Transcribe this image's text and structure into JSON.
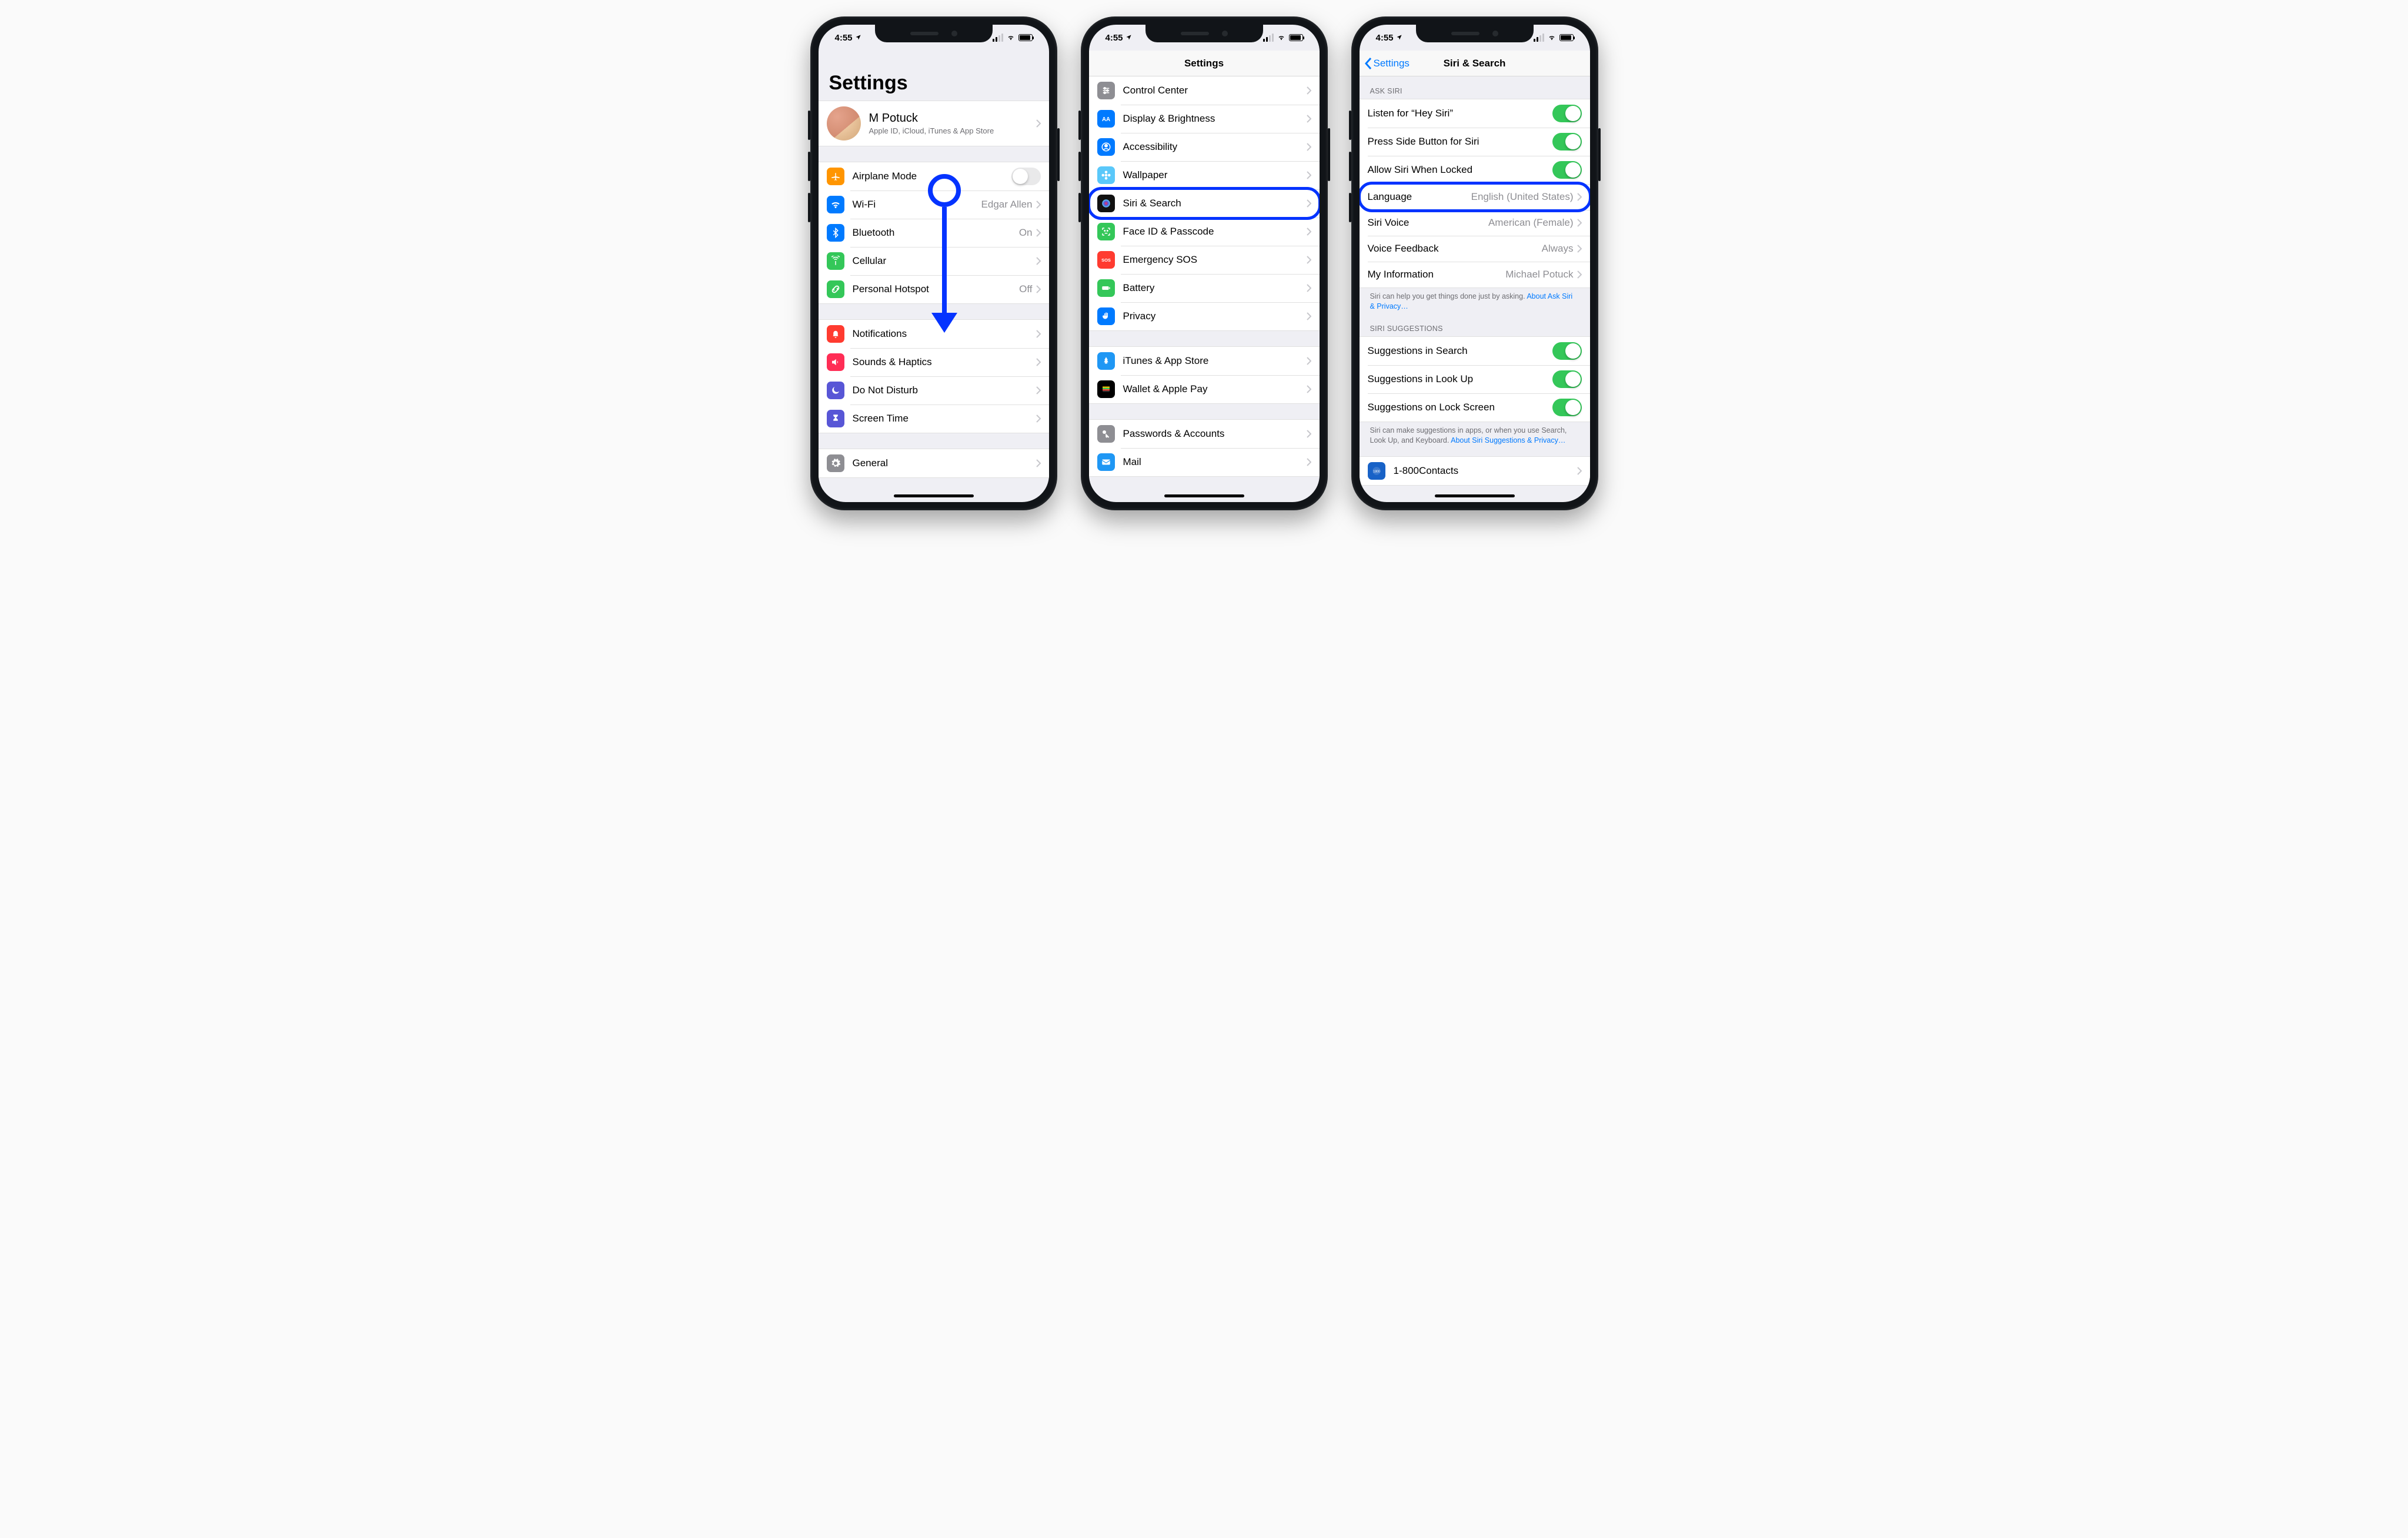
{
  "status": {
    "time": "4:55",
    "locArrow": true
  },
  "phone1": {
    "title": "Settings",
    "profile": {
      "name": "M Potuck",
      "sub": "Apple ID, iCloud, iTunes & App Store"
    },
    "g1": [
      {
        "k": "airplane",
        "label": "Airplane Mode",
        "toggle": "off"
      },
      {
        "k": "wifi",
        "label": "Wi-Fi",
        "detail": "Edgar Allen"
      },
      {
        "k": "bt",
        "label": "Bluetooth",
        "detail": "On"
      },
      {
        "k": "cell",
        "label": "Cellular"
      },
      {
        "k": "hotspot",
        "label": "Personal Hotspot",
        "detail": "Off"
      }
    ],
    "g2": [
      {
        "k": "notif",
        "label": "Notifications"
      },
      {
        "k": "sounds",
        "label": "Sounds & Haptics"
      },
      {
        "k": "dnd",
        "label": "Do Not Disturb"
      },
      {
        "k": "screentime",
        "label": "Screen Time"
      }
    ],
    "g3": [
      {
        "k": "general",
        "label": "General"
      }
    ]
  },
  "phone2": {
    "navTitle": "Settings",
    "rows": [
      {
        "k": "cc",
        "label": "Control Center"
      },
      {
        "k": "display",
        "label": "Display & Brightness"
      },
      {
        "k": "access",
        "label": "Accessibility"
      },
      {
        "k": "wallpaper",
        "label": "Wallpaper"
      },
      {
        "k": "siri",
        "label": "Siri & Search",
        "hl": true
      },
      {
        "k": "faceid",
        "label": "Face ID & Passcode"
      },
      {
        "k": "sos",
        "label": "Emergency SOS"
      },
      {
        "k": "battery",
        "label": "Battery"
      },
      {
        "k": "privacy",
        "label": "Privacy"
      }
    ],
    "g2": [
      {
        "k": "itunes",
        "label": "iTunes & App Store"
      },
      {
        "k": "wallet",
        "label": "Wallet & Apple Pay"
      }
    ],
    "g3": [
      {
        "k": "passwords",
        "label": "Passwords & Accounts"
      },
      {
        "k": "mail",
        "label": "Mail"
      }
    ]
  },
  "phone3": {
    "back": "Settings",
    "navTitle": "Siri & Search",
    "askHeader": "ASK SIRI",
    "ask": [
      {
        "k": "hey",
        "label": "Listen for “Hey Siri”",
        "toggle": "on"
      },
      {
        "k": "side",
        "label": "Press Side Button for Siri",
        "toggle": "on"
      },
      {
        "k": "locked",
        "label": "Allow Siri When Locked",
        "toggle": "on"
      },
      {
        "k": "lang",
        "label": "Language",
        "detail": "English (United States)",
        "hl": true
      },
      {
        "k": "voice",
        "label": "Siri Voice",
        "detail": "American (Female)"
      },
      {
        "k": "feedback",
        "label": "Voice Feedback",
        "detail": "Always"
      },
      {
        "k": "myinfo",
        "label": "My Information",
        "detail": "Michael Potuck"
      }
    ],
    "askFooter": "Siri can help you get things done just by asking. ",
    "askFooterLink": "About Ask Siri & Privacy…",
    "sugHeader": "SIRI SUGGESTIONS",
    "sug": [
      {
        "k": "ssearch",
        "label": "Suggestions in Search",
        "toggle": "on"
      },
      {
        "k": "slookup",
        "label": "Suggestions in Look Up",
        "toggle": "on"
      },
      {
        "k": "slock",
        "label": "Suggestions on Lock Screen",
        "toggle": "on"
      }
    ],
    "sugFooter": "Siri can make suggestions in apps, or when you use Search, Look Up, and Keyboard. ",
    "sugFooterLink": "About Siri Suggestions & Privacy…",
    "app": {
      "k": "contacts",
      "label": "1-800Contacts"
    }
  },
  "icons": {
    "airplane": {
      "bg": "#ff9500",
      "g": "plane"
    },
    "wifi": {
      "bg": "#007aff",
      "g": "wifi"
    },
    "bt": {
      "bg": "#007aff",
      "g": "bt"
    },
    "cell": {
      "bg": "#34c759",
      "g": "antenna"
    },
    "hotspot": {
      "bg": "#34c759",
      "g": "link"
    },
    "notif": {
      "bg": "#ff3b30",
      "g": "bell"
    },
    "sounds": {
      "bg": "#ff2d55",
      "g": "speaker"
    },
    "dnd": {
      "bg": "#5856d6",
      "g": "moon"
    },
    "screentime": {
      "bg": "#5856d6",
      "g": "hourglass"
    },
    "general": {
      "bg": "#8e8e93",
      "g": "gear"
    },
    "cc": {
      "bg": "#8e8e93",
      "g": "sliders"
    },
    "display": {
      "bg": "#007aff",
      "g": "aa"
    },
    "access": {
      "bg": "#007aff",
      "g": "person"
    },
    "wallpaper": {
      "bg": "#5ac8fa",
      "g": "flower"
    },
    "siri": {
      "bg": "#111",
      "g": "orb"
    },
    "faceid": {
      "bg": "#34c759",
      "g": "face"
    },
    "sos": {
      "bg": "#ff3b30",
      "g": "sos"
    },
    "battery": {
      "bg": "#34c759",
      "g": "batt"
    },
    "privacy": {
      "bg": "#007aff",
      "g": "hand"
    },
    "itunes": {
      "bg": "#1f97f4",
      "g": "astore"
    },
    "wallet": {
      "bg": "#000",
      "g": "wallet"
    },
    "passwords": {
      "bg": "#8e8e93",
      "g": "key"
    },
    "mail": {
      "bg": "#1f97f4",
      "g": "env"
    },
    "contacts": {
      "bg": "#1862c7",
      "g": "1800"
    }
  }
}
